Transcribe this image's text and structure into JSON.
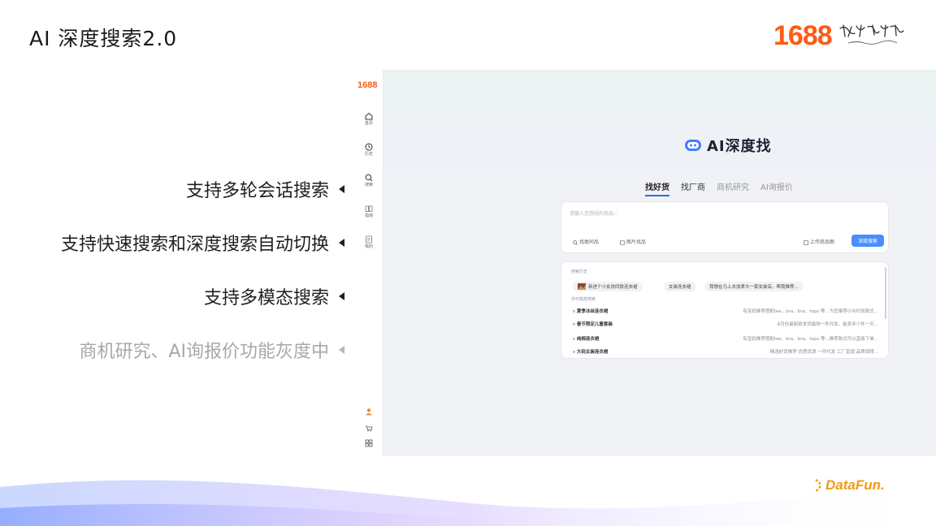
{
  "slide": {
    "title": "AI 深度搜索2.0",
    "brand_number": "1688",
    "features": [
      {
        "text": "支持多轮会话搜索",
        "muted": false
      },
      {
        "text": "支持快速搜索和深度搜索自动切换",
        "muted": false
      },
      {
        "text": "支持多模态搜索",
        "muted": false
      },
      {
        "text": "商机研究、AI询报价功能灰度中",
        "muted": true
      }
    ],
    "footer_logo": "DataFun."
  },
  "app": {
    "sidebar": {
      "logo": "1688",
      "items": [
        {
          "icon": "home-icon",
          "label": "首页"
        },
        {
          "icon": "clock-icon",
          "label": "历史"
        },
        {
          "icon": "search-icon",
          "label": "搜索"
        },
        {
          "icon": "book-icon",
          "label": "指南"
        },
        {
          "icon": "doc-icon",
          "label": "我的"
        }
      ]
    },
    "ai_title": "AI深度找",
    "tabs": [
      {
        "label": "找好货",
        "state": "active"
      },
      {
        "label": "找厂商",
        "state": "semi"
      },
      {
        "label": "商机研究",
        "state": "normal"
      },
      {
        "label": "AI询报价",
        "state": "normal"
      }
    ],
    "search": {
      "placeholder": "请输入您想找的商品~",
      "opt_1": "找类同品",
      "opt_2": "图片找品",
      "opt_3": "上传商品图",
      "button": "深度搜索"
    },
    "history": {
      "label_1": "搜索历史",
      "chips": [
        "新进个小女孩同款连衣裙",
        "女装连衣裙",
        "我想在马上去加拿大一家女装店，帮我推荐..."
      ],
      "label_2": "你可能想搜索",
      "rows": [
        {
          "q": "夏季冰丝连衣裙",
          "d": "有宝妈推荐搭配tee、bra、bra、tops 等...为您推荐小众时尚款式..."
        },
        {
          "q": "春节限定儿童套装",
          "d": "6月份最新款发货最快一件代发，能卖多少件一天..."
        },
        {
          "q": "纯棉连衣裙",
          "d": "有宝妈推荐搭配tee、bra、bra、tops 等...推荐款式可以直接下单..."
        },
        {
          "q": "大码女装连衣裙",
          "d": "精选好货推荐 优质货源 一件代发 工厂直销 品质保障..."
        }
      ]
    }
  },
  "colors": {
    "brand_orange": "#ff5a14",
    "accent_blue": "#4a8dff",
    "datafun_orange": "#f29a12"
  }
}
